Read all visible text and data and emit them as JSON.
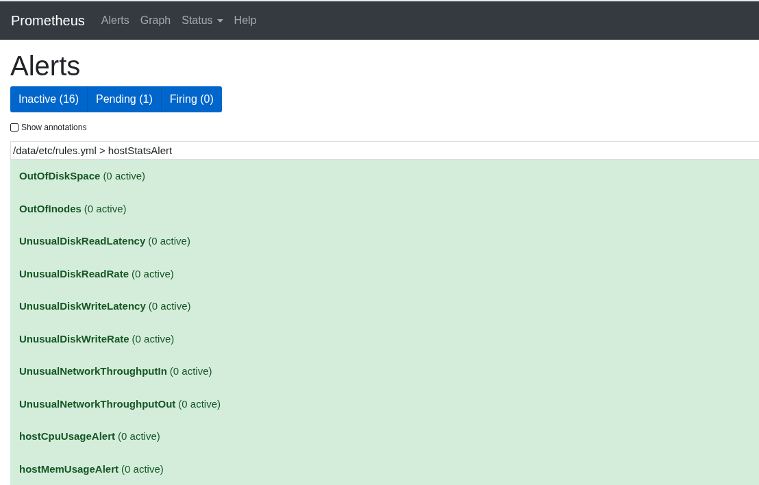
{
  "navbar": {
    "brand": "Prometheus",
    "links": [
      {
        "label": "Alerts",
        "dropdown": false
      },
      {
        "label": "Graph",
        "dropdown": false
      },
      {
        "label": "Status",
        "dropdown": true
      },
      {
        "label": "Help",
        "dropdown": false
      }
    ]
  },
  "title": "Alerts",
  "filters": [
    "Inactive (16)",
    "Pending (1)",
    "Firing (0)"
  ],
  "show_annotations": {
    "label": "Show annotations",
    "checked": false
  },
  "group": {
    "header": "/data/etc/rules.yml > hostStatsAlert",
    "rules": [
      {
        "name": "OutOfDiskSpace",
        "count": "(0 active)"
      },
      {
        "name": "OutOfInodes",
        "count": "(0 active)"
      },
      {
        "name": "UnusualDiskReadLatency",
        "count": "(0 active)"
      },
      {
        "name": "UnusualDiskReadRate",
        "count": "(0 active)"
      },
      {
        "name": "UnusualDiskWriteLatency",
        "count": "(0 active)"
      },
      {
        "name": "UnusualDiskWriteRate",
        "count": "(0 active)"
      },
      {
        "name": "UnusualNetworkThroughputIn",
        "count": "(0 active)"
      },
      {
        "name": "UnusualNetworkThroughputOut",
        "count": "(0 active)"
      },
      {
        "name": "hostCpuUsageAlert",
        "count": "(0 active)"
      },
      {
        "name": "hostMemUsageAlert",
        "count": "(0 active)"
      }
    ]
  }
}
